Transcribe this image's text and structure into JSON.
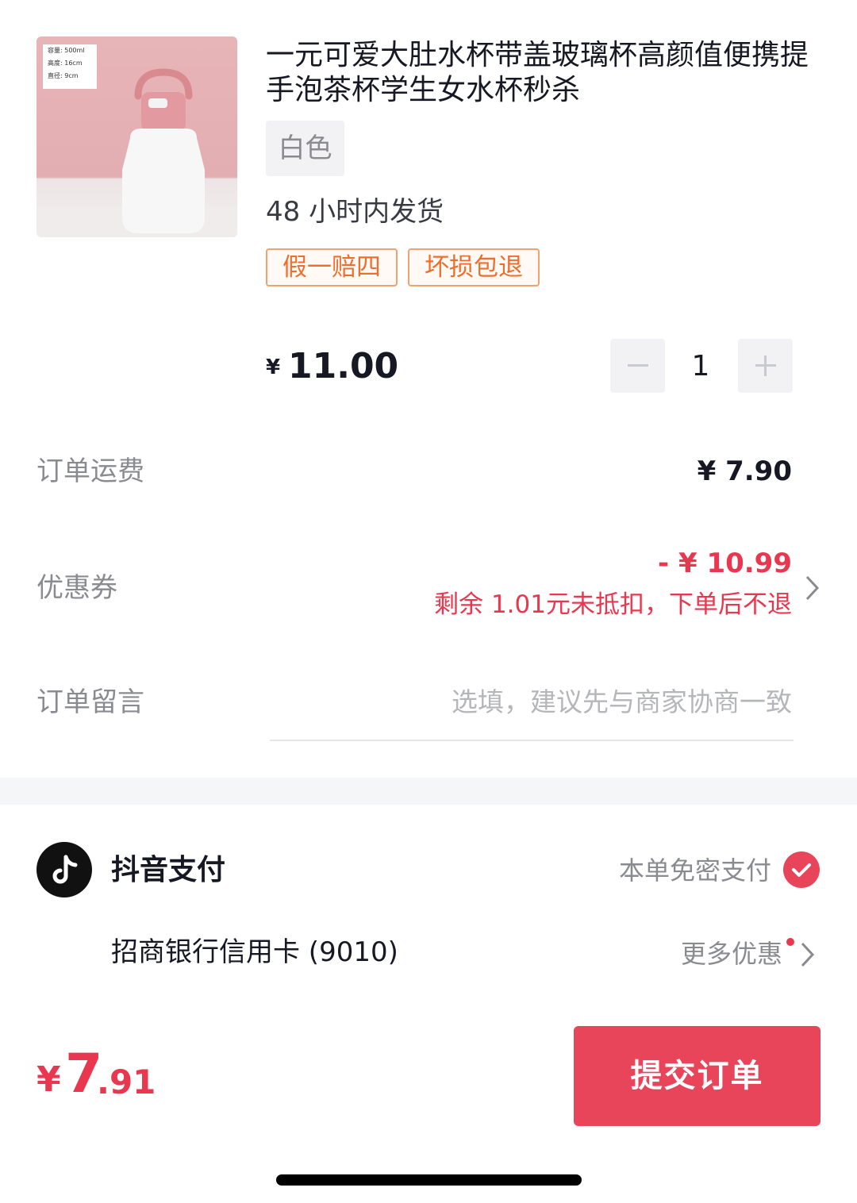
{
  "product": {
    "title": "一元可爱大肚水杯带盖玻璃杯高颜值便携提手泡茶杯学生女水杯秒杀",
    "image": {
      "spec_lines": [
        "容量: 500ml",
        "高度: 16cm",
        "直径: 9cm"
      ]
    },
    "variant": "白色",
    "shipping_note": "48 小时内发货",
    "badges": [
      "假一赔四",
      "坏损包退"
    ],
    "price_symbol": "¥",
    "price": "11.00",
    "quantity": "1",
    "qty_minus": "−",
    "qty_plus": "+"
  },
  "order": {
    "shipping_label": "订单运费",
    "shipping_value": "¥ 7.90",
    "coupon_label": "优惠券",
    "coupon_value": "- ¥ 10.99",
    "coupon_note": "剩余 1.01元未抵扣，下单后不退",
    "message_label": "订单留言",
    "message_placeholder": "选填，建议先与商家协商一致"
  },
  "payment": {
    "method": "抖音支付",
    "no_password": "本单免密支付",
    "card": "招商银行信用卡 (9010)",
    "more_offers": "更多优惠"
  },
  "footer": {
    "total_symbol": "¥",
    "total_int": "7",
    "total_dec": ".91",
    "submit": "提交订单"
  },
  "colors": {
    "accent_red": "#e8374f",
    "badge_orange": "#ee6f2d",
    "text_primary": "#161823",
    "text_secondary": "#8a8b91"
  }
}
